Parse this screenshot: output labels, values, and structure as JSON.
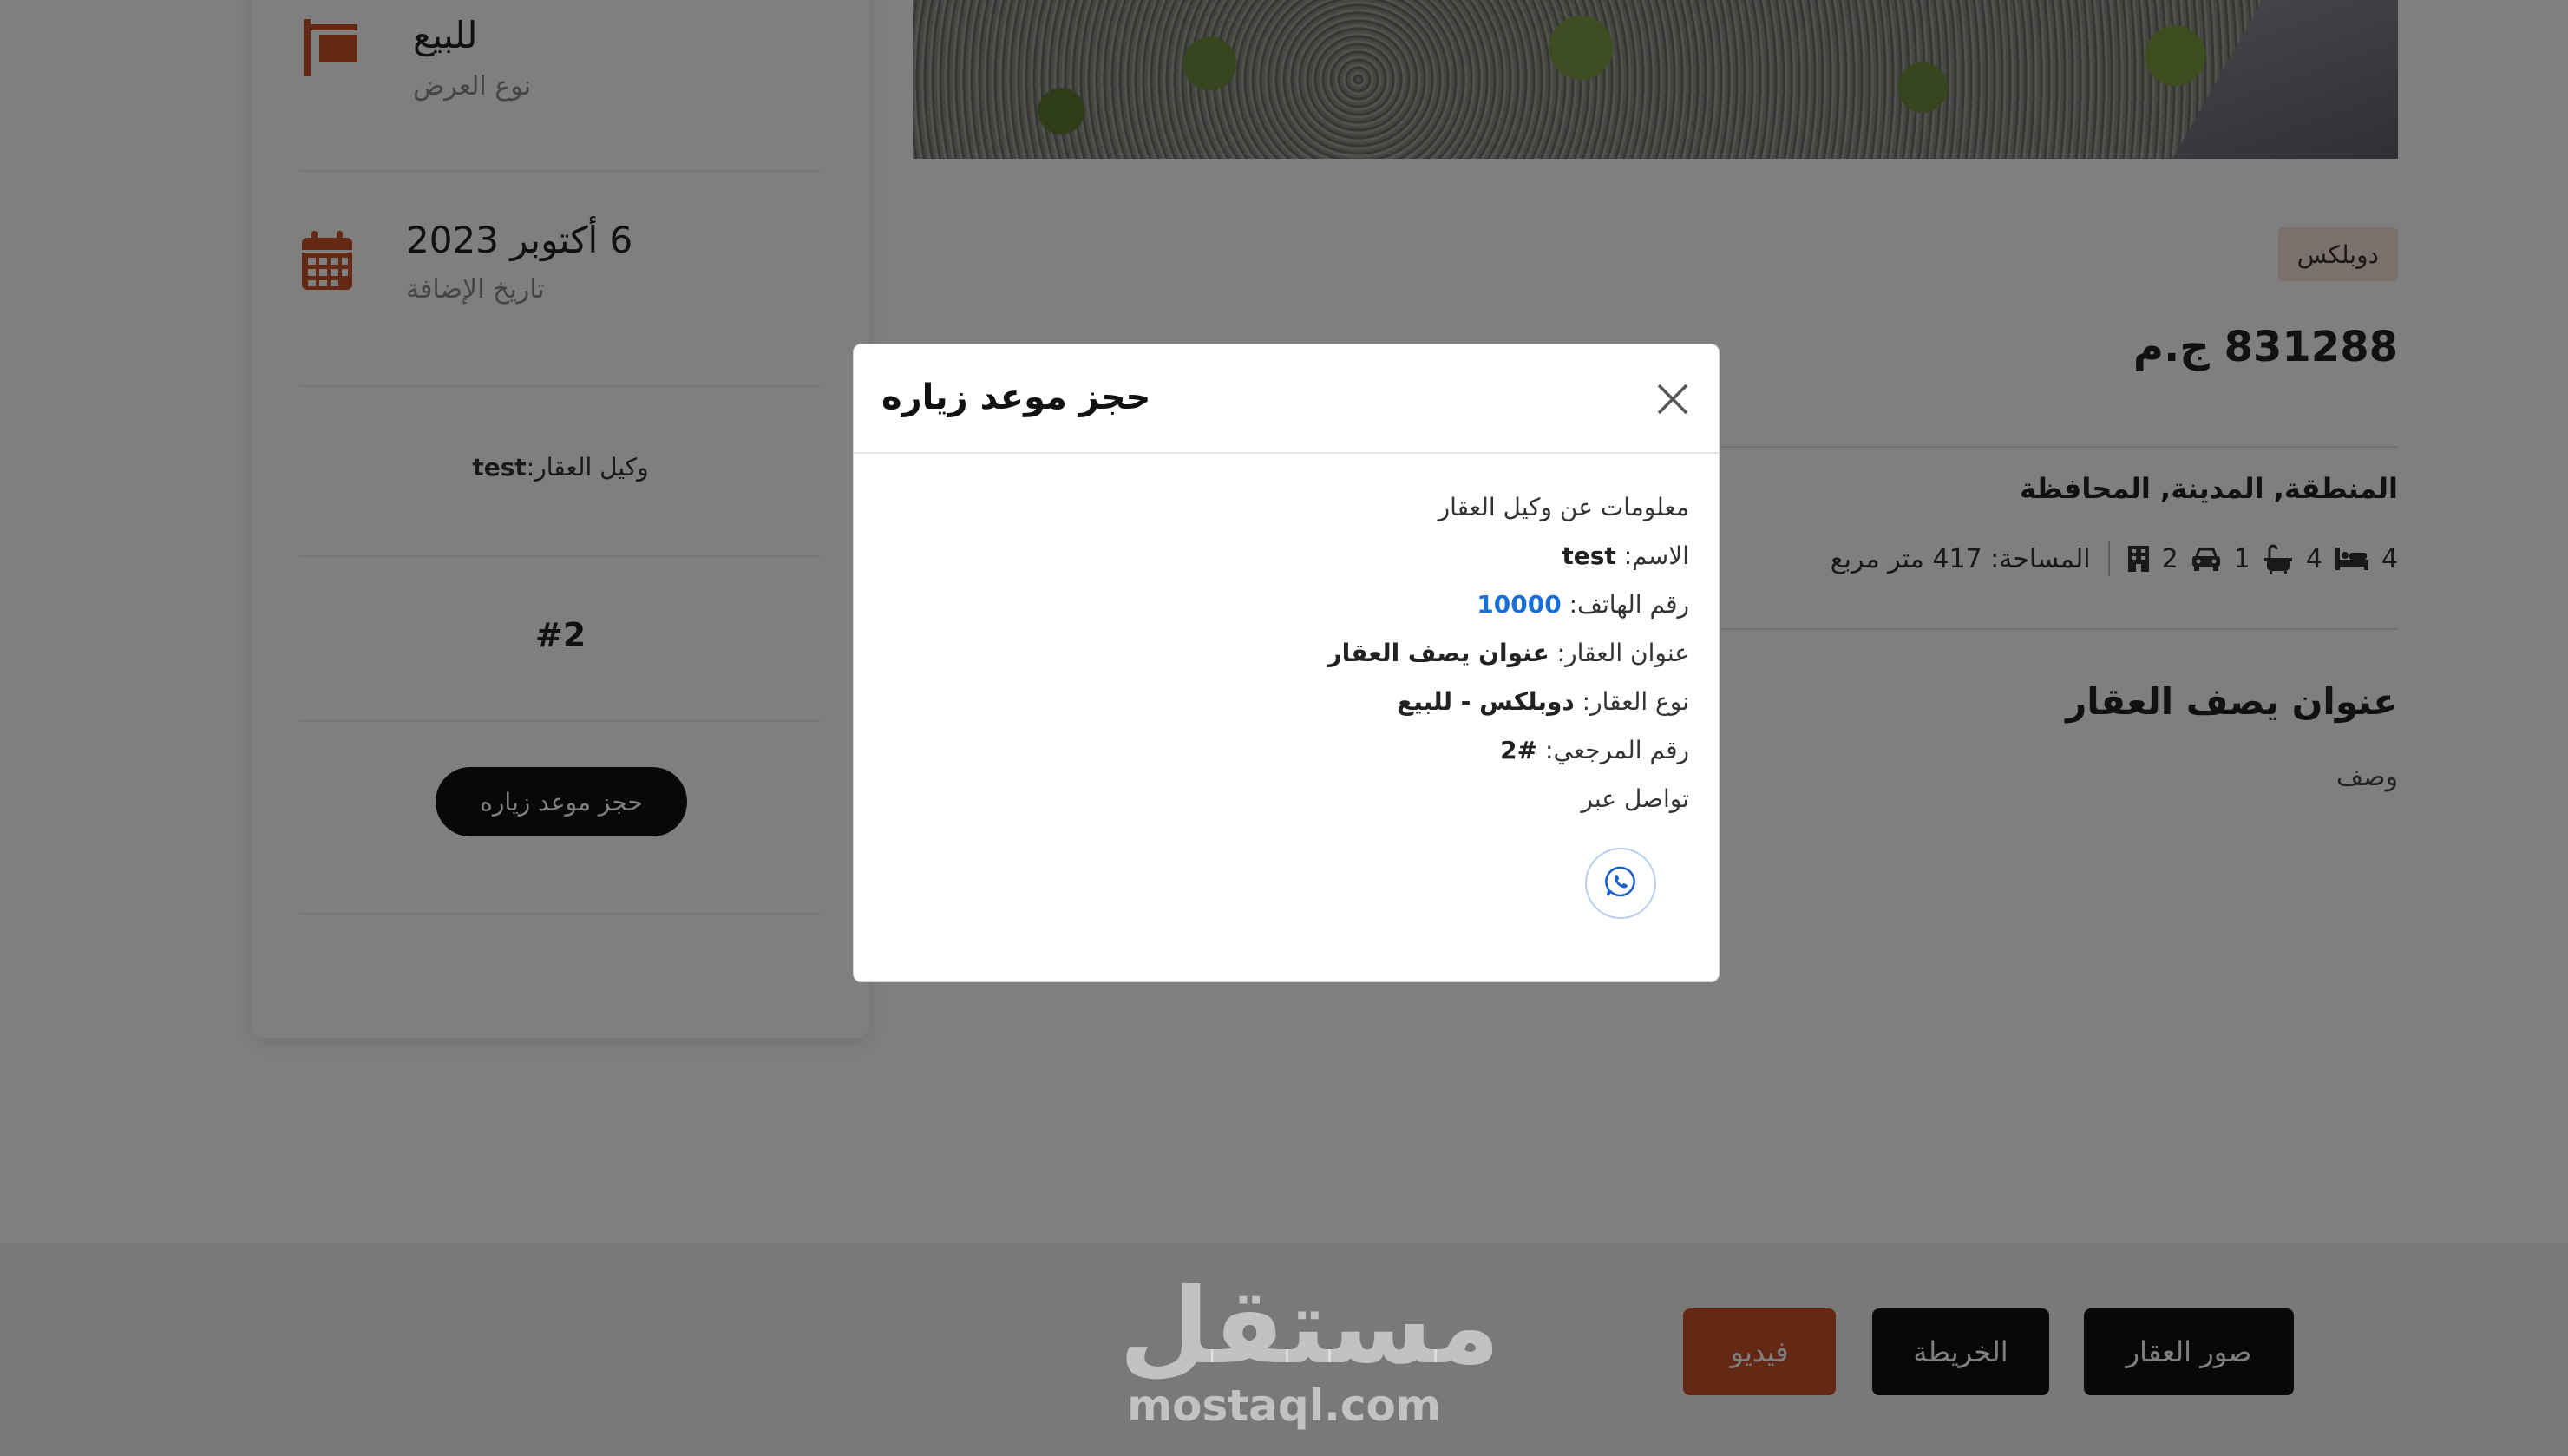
{
  "sidebar": {
    "offer_type": {
      "value": "للبيع",
      "label": "نوع العرض"
    },
    "date_added": {
      "value": "6 أكتوبر 2023",
      "label": "تاريخ الإضافة"
    },
    "agent": {
      "label": "وكيل العقار:",
      "name": "test"
    },
    "reference": "#2",
    "book_button": "حجز موعد زياره"
  },
  "property": {
    "type_badge": "دوبلكس",
    "price": "831288 ج.م",
    "location": "المنطقة, المدينة, المحافظة",
    "features": {
      "bedrooms": "4",
      "bathrooms": "4",
      "parking": "1",
      "floors": "2",
      "area": "المساحة: 417 متر مربع"
    },
    "title": "عنوان يصف العقار",
    "description": "وصف"
  },
  "tabs": {
    "photos": "صور العقار",
    "map": "الخريطة",
    "video": "فيديو"
  },
  "modal": {
    "title": "حجز موعد زياره",
    "heading": "معلومات عن وكيل العقار",
    "name_label": "الاسم:",
    "name_value": "test",
    "phone_label": "رقم الهاتف:",
    "phone_value": "10000",
    "address_label": "عنوان العقار:",
    "address_value": "عنوان يصف العقار",
    "type_label": "نوع العقار:",
    "type_value": "دوبلكس - للبيع",
    "ref_label": "رقم المرجعي:",
    "ref_value": "#2",
    "contact_via": "تواصل عبر"
  },
  "watermark": {
    "arabic": "مستقل",
    "latin": "mostaql.com"
  },
  "colors": {
    "accent": "#c9522b",
    "badge_bg": "#f7e1d8",
    "phone_link": "#1a6fd4",
    "overlay": "rgba(0,0,0,0.5)"
  }
}
